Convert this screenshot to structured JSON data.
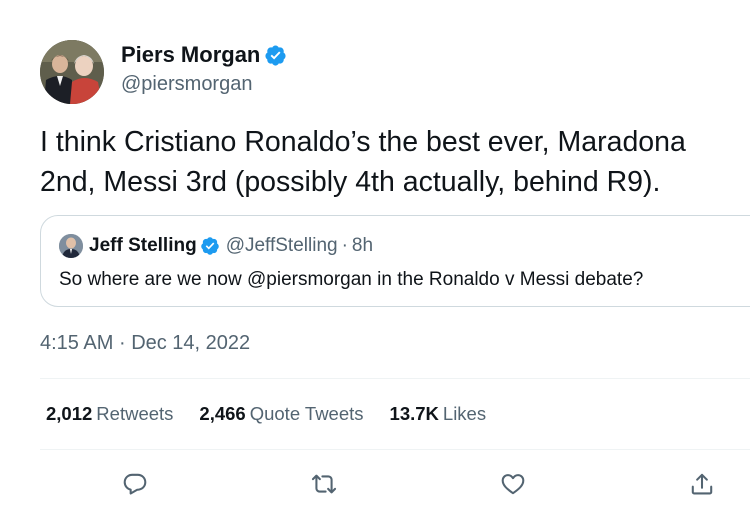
{
  "author": {
    "name": "Piers Morgan",
    "handle": "@piersmorgan",
    "verified": true,
    "avatar": "profile-photo"
  },
  "tweet": {
    "line1": "I think Cristiano Ronaldo’s the best ever, Maradona",
    "line2": "2nd, Messi 3rd (possibly 4th actually, behind R9)."
  },
  "quoted_tweet": {
    "name": "Jeff Stelling",
    "handle": "@JeffStelling",
    "dot": "·",
    "time": "8h",
    "verified": true,
    "text": "So where are we now @piersmorgan in the Ronaldo v Messi debate?"
  },
  "meta": {
    "time": "4:15 AM",
    "separator": "·",
    "date": "Dec 14, 2022"
  },
  "stats": {
    "retweets_count": "2,012",
    "retweets_label": "Retweets",
    "quotes_count": "2,466",
    "quotes_label": "Quote Tweets",
    "likes_count": "13.7K",
    "likes_label": "Likes"
  },
  "actions": [
    "reply-icon",
    "retweet-icon",
    "like-icon",
    "share-icon"
  ],
  "colors": {
    "verified": "#1d9bf0",
    "text": "#0f1419",
    "secondary": "#536471",
    "border": "#cfd9de"
  }
}
